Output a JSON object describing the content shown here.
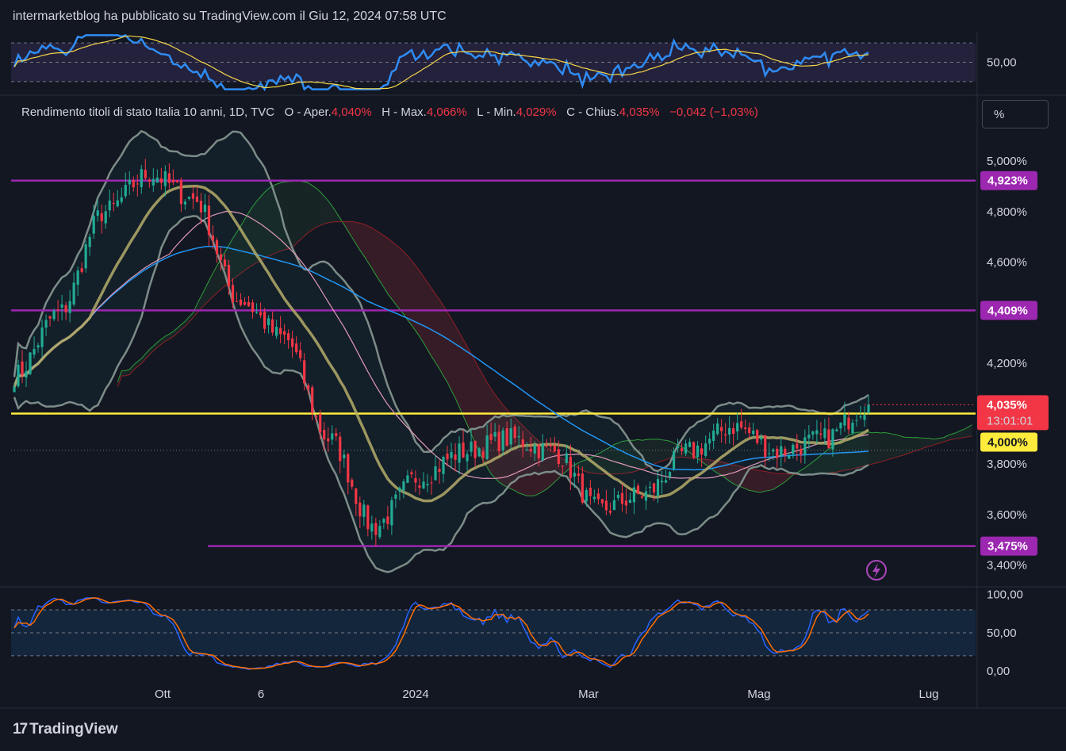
{
  "header": {
    "title": "intermarketblog ha pubblicato su TradingView.com il Giu 12, 2024 07:58 UTC"
  },
  "legend": {
    "symbol": "Rendimento titoli di stato Italia 10 anni, 1D, TVC",
    "open_label": "O - Aper.",
    "open": "4,040%",
    "high_label": "H - Max.",
    "high": "4,066%",
    "low_label": "L - Min.",
    "low": "4,029%",
    "close_label": "C - Chius.",
    "close": "4,035%",
    "change": "−0,042 (−1,03%)"
  },
  "unit_button": "%",
  "branding": {
    "logo_mark": "17",
    "logo_text": "TradingView"
  },
  "colors": {
    "up": "#22ab94",
    "down": "#f23645",
    "level": "#9c27b0",
    "yellow": "#ffeb3b",
    "ma200": "#2196f3",
    "ma_pink": "#e29ab8",
    "bollinger": "#7c8c88",
    "basis": "#b5ad6a"
  },
  "chart_data": [
    {
      "type": "line",
      "name": "rsi_panel",
      "y_tick_labels": [
        "50,00"
      ],
      "y_tick_values": [
        50
      ],
      "ylim": [
        20,
        80
      ],
      "bands": [
        30,
        50,
        70
      ]
    },
    {
      "type": "candlestick",
      "name": "main_price",
      "x_tick_labels": [
        "Ott",
        "6",
        "2024",
        "Mar",
        "Mag",
        "Lug"
      ],
      "y_tick_labels": [
        "5,000%",
        "4,800%",
        "4,600%",
        "4,200%",
        "3,800%",
        "3,600%",
        "3,400%"
      ],
      "y_tick_values": [
        5.0,
        4.8,
        4.6,
        4.2,
        3.8,
        3.6,
        3.4
      ],
      "ylim": [
        3.32,
        5.12
      ],
      "levels": [
        {
          "label": "4,923%",
          "value": 4.923,
          "color": "#9c27b0"
        },
        {
          "label": "4,409%",
          "value": 4.409,
          "color": "#9c27b0"
        },
        {
          "label": "3,475%",
          "value": 3.475,
          "color": "#9c27b0"
        }
      ],
      "horizontal_line": {
        "label": "4,000%",
        "value": 4.0,
        "color": "#ffeb3b"
      },
      "last_price": {
        "label": "4,035%",
        "countdown": "13:01:01",
        "value": 4.035
      },
      "approx_closes": [
        {
          "x": "Ago 2023",
          "y": 4.15
        },
        {
          "x": "Set 2023",
          "y": 4.4
        },
        {
          "x": "Set 2023 b",
          "y": 4.8
        },
        {
          "x": "Ott 2023",
          "y": 4.95
        },
        {
          "x": "Ott 2023 b",
          "y": 4.85
        },
        {
          "x": "Nov 2023",
          "y": 4.45
        },
        {
          "x": "Nov 2023 b",
          "y": 4.3
        },
        {
          "x": "Dic 2023",
          "y": 3.9
        },
        {
          "x": "Dic 2023 b",
          "y": 3.55
        },
        {
          "x": "Gen 2024",
          "y": 3.75
        },
        {
          "x": "Gen 2024 b",
          "y": 3.85
        },
        {
          "x": "Feb 2024",
          "y": 3.9
        },
        {
          "x": "Feb 2024 b",
          "y": 3.85
        },
        {
          "x": "Mar 2024",
          "y": 3.62
        },
        {
          "x": "Mar 2024 b",
          "y": 3.68
        },
        {
          "x": "Apr 2024",
          "y": 3.85
        },
        {
          "x": "Apr 2024 b",
          "y": 3.95
        },
        {
          "x": "Mag 2024",
          "y": 3.85
        },
        {
          "x": "Mag 2024 b",
          "y": 3.9
        },
        {
          "x": "Giu 2024",
          "y": 4.035
        }
      ]
    },
    {
      "type": "line",
      "name": "stochastic_panel",
      "y_tick_labels": [
        "100,00",
        "50,00",
        "0,00"
      ],
      "y_tick_values": [
        100,
        50,
        0
      ],
      "ylim": [
        -6,
        108
      ],
      "bands": [
        20,
        50,
        80
      ]
    }
  ]
}
